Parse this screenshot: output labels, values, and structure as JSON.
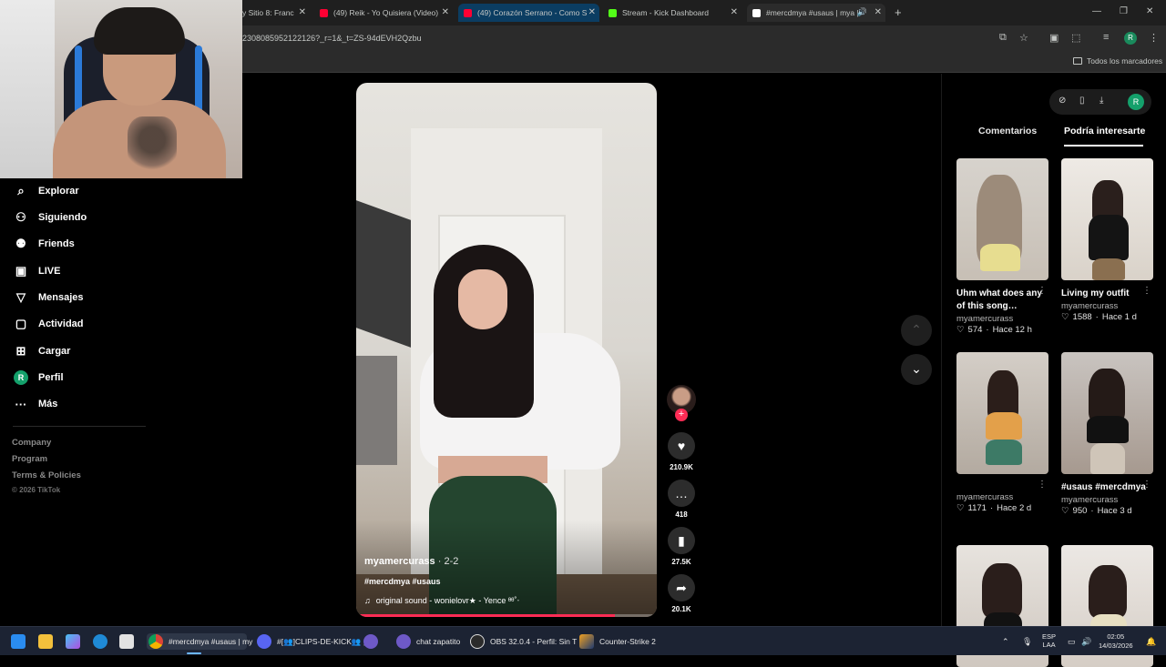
{
  "browser": {
    "tabs": [
      {
        "label": "y Sitio 8: Franc",
        "fav_color": "#6a6a6a"
      },
      {
        "label": "(49) Reik - Yo Quisiera (Video)",
        "fav_color": "#ff0033"
      },
      {
        "label": "(49) Corazón Serrano - Como S",
        "fav_color": "#ff0033"
      },
      {
        "label": "Stream - Kick Dashboard",
        "fav_color": "#53fc18"
      },
      {
        "label": "#mercdmya #usaus | mya |",
        "fav_color": "#ffffff"
      }
    ],
    "new_tab_icon": "+",
    "url": "2308085952122126?_r=1&_t=ZS-94dEVH2Qzbu",
    "profile_initial": "R",
    "bookmarks_all_label": "Todos los marcadores"
  },
  "leftnav": {
    "items": [
      {
        "label": "Explorar",
        "icon": "compass-icon",
        "glyph": "⌕"
      },
      {
        "label": "Siguiendo",
        "icon": "following-icon",
        "glyph": "⚇"
      },
      {
        "label": "Friends",
        "icon": "friends-icon",
        "glyph": "⚉"
      },
      {
        "label": "LIVE",
        "icon": "live-icon",
        "glyph": "▣"
      },
      {
        "label": "Mensajes",
        "icon": "messages-icon",
        "glyph": "▽"
      },
      {
        "label": "Actividad",
        "icon": "activity-icon",
        "glyph": "▢"
      },
      {
        "label": "Cargar",
        "icon": "upload-icon",
        "glyph": "⊞"
      },
      {
        "label": "Perfil",
        "icon": "profile-avatar",
        "glyph": "R"
      },
      {
        "label": "Más",
        "icon": "more-icon",
        "glyph": "···"
      }
    ],
    "footer": [
      "Company",
      "Program",
      "Terms & Policies"
    ],
    "copyright": "© 2026 TikTok"
  },
  "video": {
    "author": "myamercurass",
    "date": "2-2",
    "separator": " · ",
    "tags": "#mercdmya #usaus",
    "sound_icon": "♫",
    "sound": "original sound - wonielovr★ - Yence ᶿᶿ˚‧",
    "progress_pct": 86,
    "actions": {
      "likes": "210.9K",
      "comments": "418",
      "saves": "27.5K",
      "shares": "20.1K"
    }
  },
  "rightpanel": {
    "profile_initial": "R",
    "tabs": {
      "comments": "Comentarios",
      "interest": "Podría interesarte"
    },
    "cards": [
      {
        "title": "Uhm what does any of this song…",
        "author": "myamercurass",
        "likes": "574",
        "age": "Hace 12 h"
      },
      {
        "title": "Living my outfit",
        "author": "myamercurass",
        "likes": "1588",
        "age": "Hace 1 d"
      },
      {
        "title": "",
        "author": "myamercurass",
        "likes": "1171",
        "age": "Hace 2 d"
      },
      {
        "title": "#usaus #mercdmya",
        "author": "myamercurass",
        "likes": "950",
        "age": "Hace 3 d"
      }
    ]
  },
  "taskbar": {
    "apps": [
      {
        "label": "#mercdmya #usaus | my",
        "icon": "chrome-icon"
      },
      {
        "label": "#[👥]CLIPS-DE-KICK👥 |",
        "icon": "discord-icon"
      },
      {
        "label": "chat zapatito",
        "icon": "app-icon"
      },
      {
        "label": "OBS 32.0.4 - Perfil: Sin T",
        "icon": "obs-icon"
      },
      {
        "label": "Counter-Strike 2",
        "icon": "cs2-icon"
      }
    ],
    "lang": "ESP",
    "lang2": "LAA",
    "time": "02:05",
    "date": "14/03/2026"
  }
}
